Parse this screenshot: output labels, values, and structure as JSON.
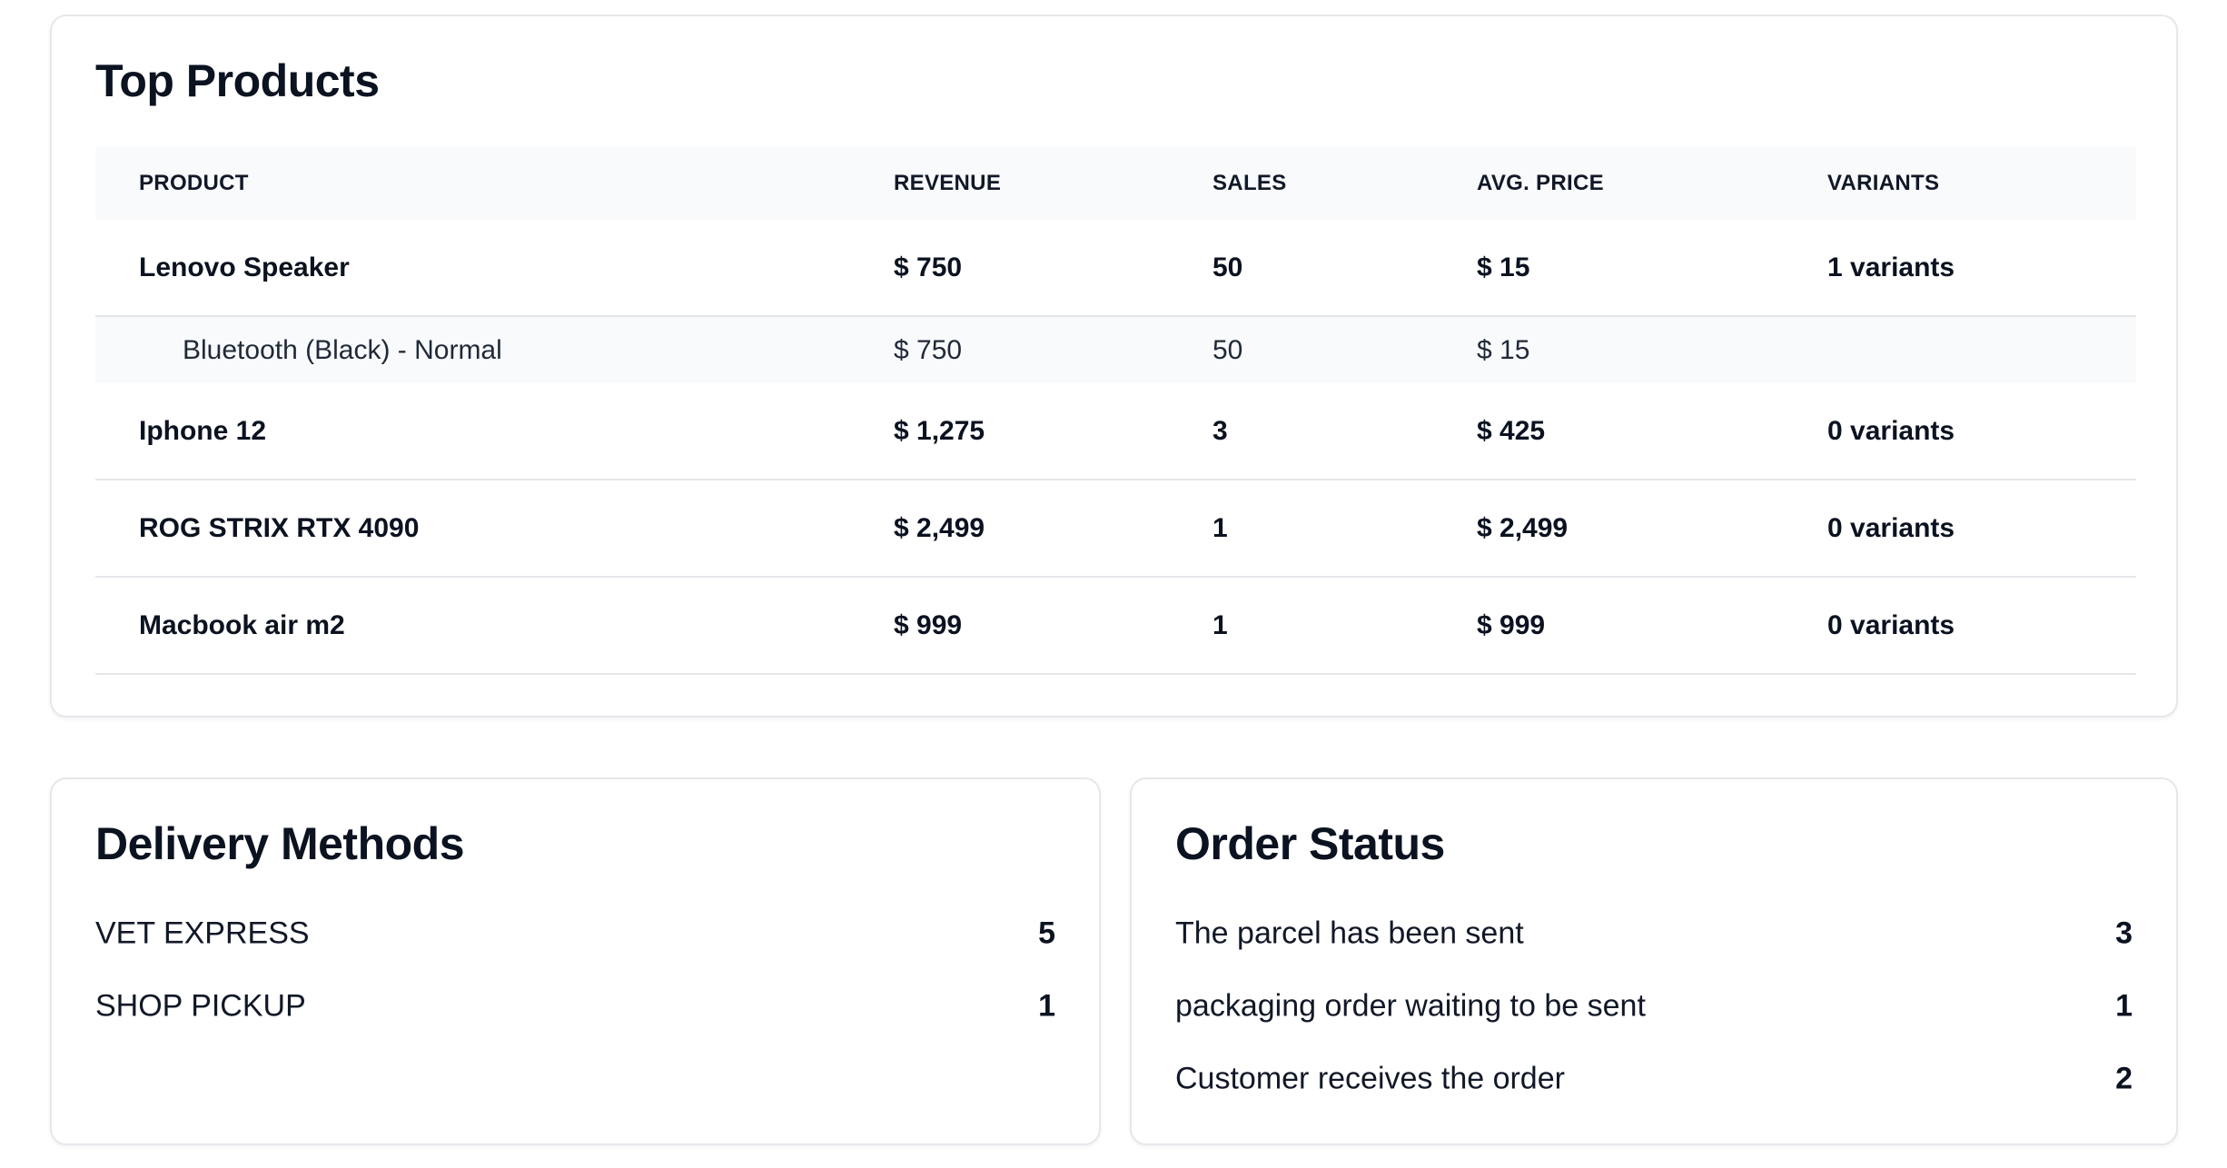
{
  "top_products": {
    "title": "Top Products",
    "columns": {
      "product": "PRODUCT",
      "revenue": "REVENUE",
      "sales": "SALES",
      "avg_price": "AVG. PRICE",
      "variants": "VARIANTS"
    },
    "rows": [
      {
        "product": "Lenovo Speaker",
        "revenue": "$ 750",
        "sales": "50",
        "avg_price": "$ 15",
        "variants": "1 variants"
      },
      {
        "product": "Bluetooth (Black) - Normal",
        "revenue": "$ 750",
        "sales": "50",
        "avg_price": "$ 15",
        "variants": ""
      },
      {
        "product": "Iphone 12",
        "revenue": "$ 1,275",
        "sales": "3",
        "avg_price": "$ 425",
        "variants": "0 variants"
      },
      {
        "product": "ROG STRIX RTX 4090",
        "revenue": "$ 2,499",
        "sales": "1",
        "avg_price": "$ 2,499",
        "variants": "0 variants"
      },
      {
        "product": "Macbook air m2",
        "revenue": "$ 999",
        "sales": "1",
        "avg_price": "$ 999",
        "variants": "0 variants"
      }
    ]
  },
  "delivery_methods": {
    "title": "Delivery Methods",
    "items": [
      {
        "label": "VET EXPRESS",
        "count": "5"
      },
      {
        "label": "SHOP PICKUP",
        "count": "1"
      }
    ]
  },
  "order_status": {
    "title": "Order Status",
    "items": [
      {
        "label": "The parcel has been sent",
        "count": "3"
      },
      {
        "label": "packaging order waiting to be sent",
        "count": "1"
      },
      {
        "label": "Customer receives the order",
        "count": "2"
      }
    ]
  }
}
